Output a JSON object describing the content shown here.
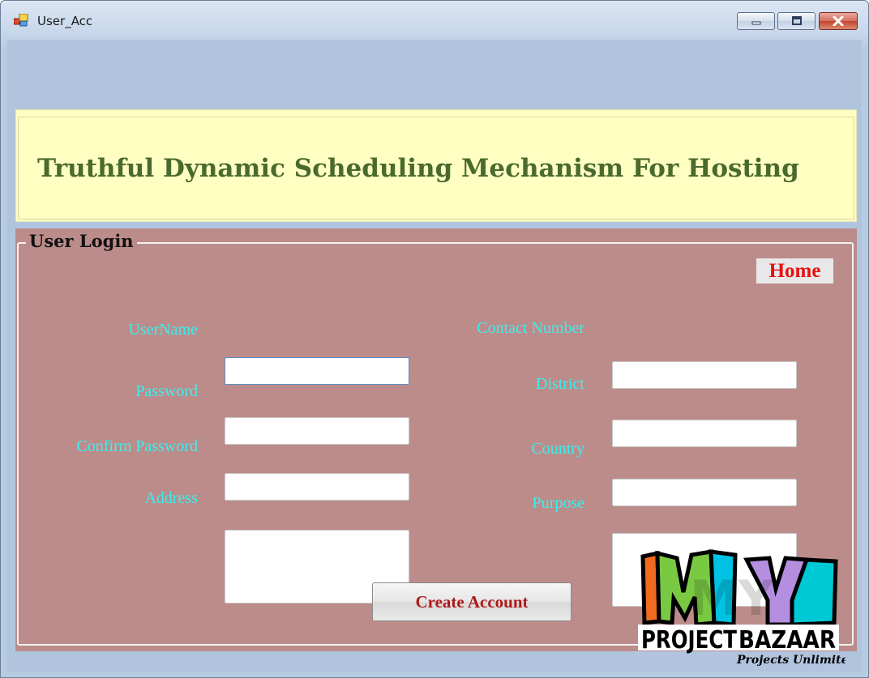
{
  "window": {
    "title": "User_Acc"
  },
  "banner": {
    "title": "Truthful Dynamic Scheduling Mechanism For Hosting"
  },
  "group": {
    "title": "User Login"
  },
  "home": {
    "label": "Home"
  },
  "form": {
    "username": {
      "label": "UserName",
      "value": ""
    },
    "password": {
      "label": "Password",
      "value": ""
    },
    "confirm_password": {
      "label": "Confirm Password",
      "value": ""
    },
    "address": {
      "label": "Address",
      "value": ""
    },
    "contact_number": {
      "label": "Contact Number",
      "value": ""
    },
    "district": {
      "label": "District",
      "value": ""
    },
    "country": {
      "label": "Country",
      "value": ""
    },
    "purpose": {
      "label": "Purpose",
      "value": ""
    }
  },
  "create_button": {
    "label": "Create Account"
  },
  "logo": {
    "line1": "PROJECT",
    "line2": "BAZAAR",
    "tagline": "Projects Unlimited",
    "letters": "MY"
  },
  "colors": {
    "label_text": "#39f0f0",
    "panel_bg": "#bc8c8a",
    "banner_bg": "#ffffc2",
    "banner_text": "#4a6a2e",
    "home_text": "#e81010",
    "button_text": "#b01818"
  }
}
